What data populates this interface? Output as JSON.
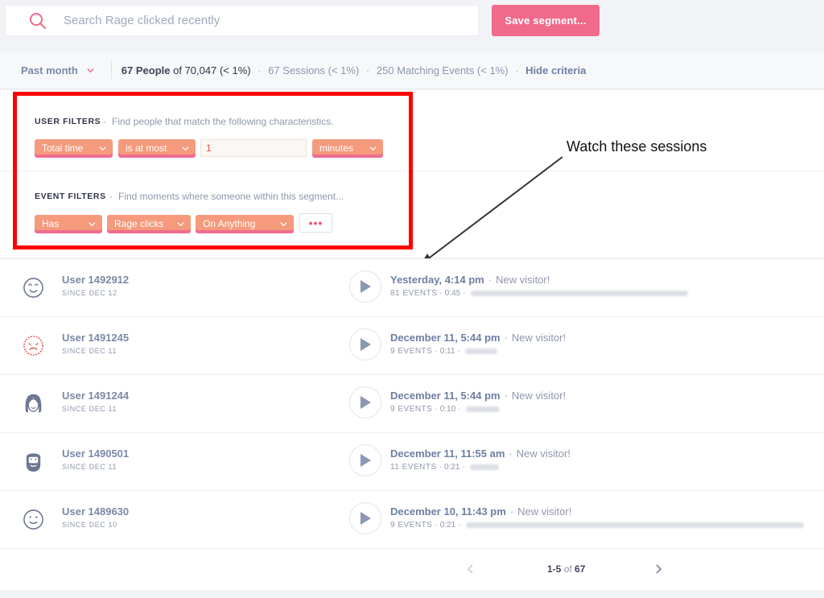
{
  "search": {
    "placeholder": "Search Rage clicked recently"
  },
  "toolbar": {
    "save_label": "Save segment..."
  },
  "criteria": {
    "period": "Past month",
    "people_count": "67 People",
    "people_of": "of 70,047 (< 1%)",
    "sessions": "67 Sessions (< 1%)",
    "events": "250 Matching Events (< 1%)",
    "hide": "Hide criteria"
  },
  "user_filters": {
    "label": "USER FILTERS",
    "desc": "Find people that match the following characteristics.",
    "field": "Total time",
    "operator": "is at most",
    "value": "1",
    "unit": "minutes"
  },
  "event_filters": {
    "label": "EVENT FILTERS",
    "desc": "Find moments where someone within this segment...",
    "verb": "Has",
    "event": "Rage clicks",
    "target": "On Anything",
    "more": "•••"
  },
  "annotation": "Watch these sessions",
  "sessions": [
    {
      "user": "User 1492912",
      "since": "SINCE DEC 12",
      "date": "Yesterday, 4:14 pm",
      "visitor": "New visitor!",
      "events": "81 EVENTS",
      "duration": "0:45",
      "avatar": "smile-face-icon"
    },
    {
      "user": "User 1491245",
      "since": "SINCE DEC 11",
      "date": "December 11, 5:44 pm",
      "visitor": "New visitor!",
      "events": "9 EVENTS",
      "duration": "0:11",
      "avatar": "red-face-icon"
    },
    {
      "user": "User 1491244",
      "since": "SINCE DEC 11",
      "date": "December 11, 5:44 pm",
      "visitor": "New visitor!",
      "events": "9 EVENTS",
      "duration": "0:10",
      "avatar": "long-hair-face-icon"
    },
    {
      "user": "User 1490501",
      "since": "SINCE DEC 11",
      "date": "December 11, 11:55 am",
      "visitor": "New visitor!",
      "events": "11 EVENTS",
      "duration": "0:21",
      "avatar": "bearded-face-icon"
    },
    {
      "user": "User 1489630",
      "since": "SINCE DEC 10",
      "date": "December 10, 11:43 pm",
      "visitor": "New visitor!",
      "events": "9 EVENTS",
      "duration": "0:21",
      "avatar": "smile-face-icon"
    }
  ],
  "pager": {
    "range": "1-5",
    "of": "of",
    "total": "67"
  },
  "colors": {
    "accent": "#f06a8b",
    "chip": "#f59a7c",
    "highlight_box": "#ff0000",
    "link": "#6e7fa3"
  }
}
